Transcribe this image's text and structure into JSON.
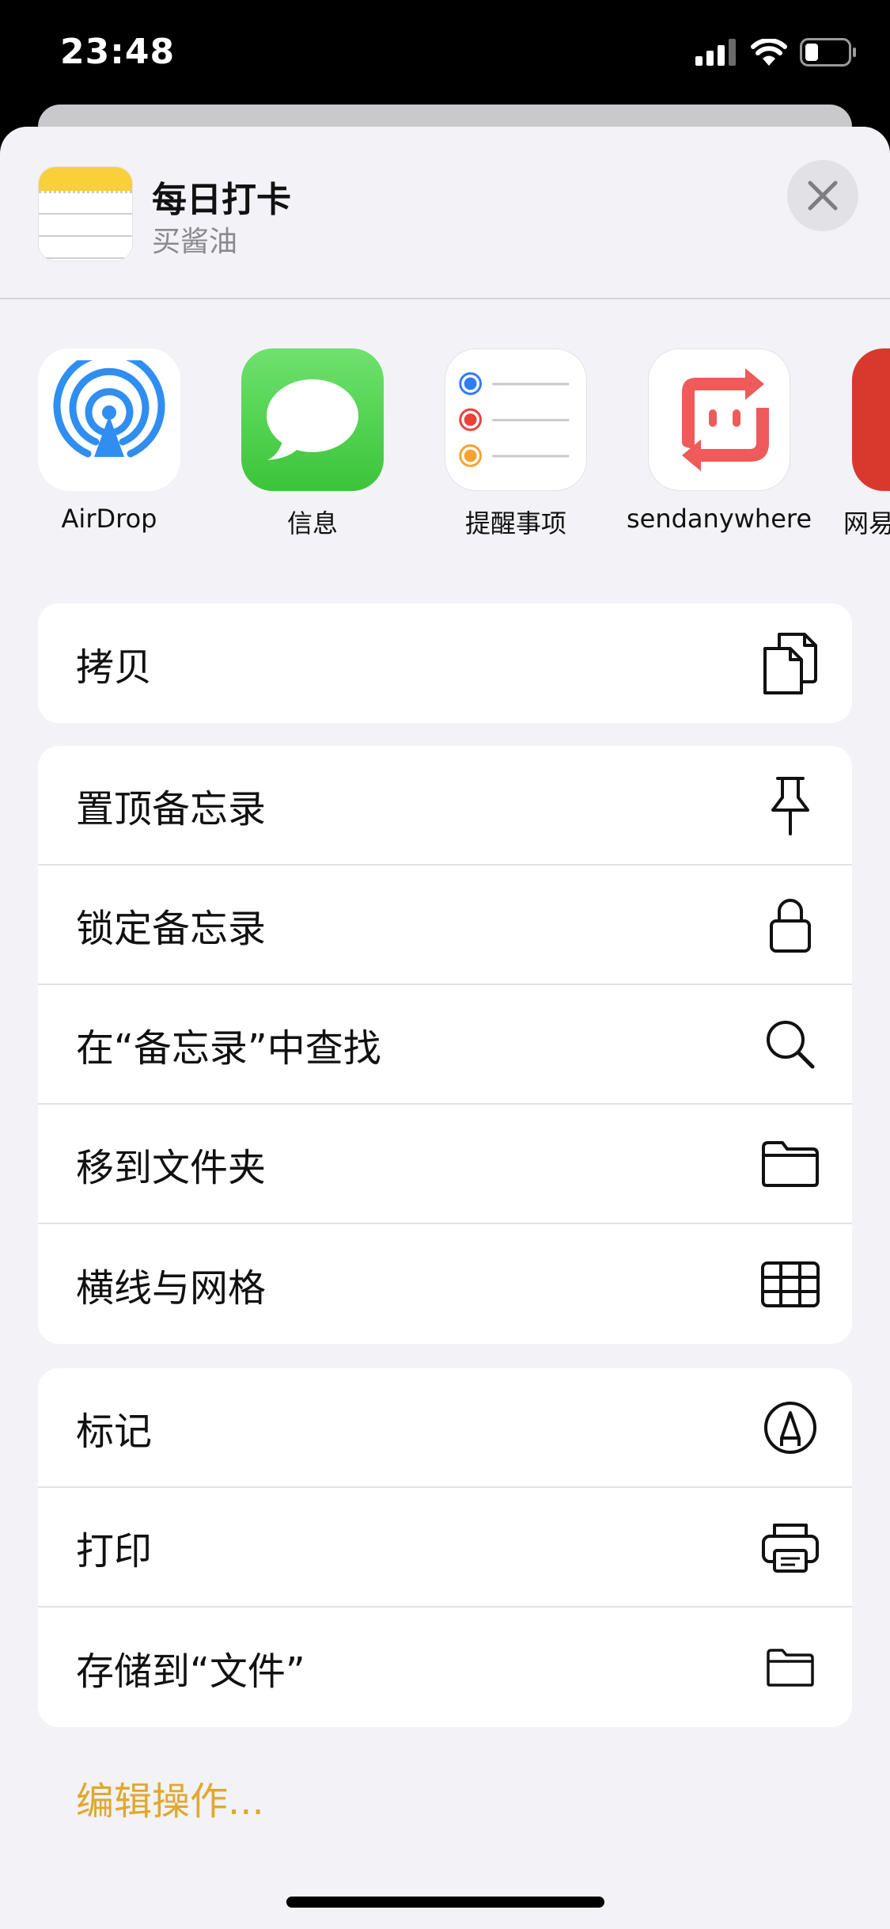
{
  "status_bar": {
    "time": "23:48",
    "icons": [
      "signal-icon",
      "wifi-icon",
      "battery-icon"
    ]
  },
  "header": {
    "title": "每日打卡",
    "subtitle": "买酱油",
    "icon": "notes-app-icon",
    "close_icon": "close-icon"
  },
  "apps": [
    {
      "label": "AirDrop",
      "icon": "airdrop-icon",
      "color": "#2f8ef0"
    },
    {
      "label": "信息",
      "icon": "messages-icon",
      "color": "#4cd964"
    },
    {
      "label": "提醒事项",
      "icon": "reminders-icon",
      "color": "#ffffff"
    },
    {
      "label": "sendanywhere",
      "icon": "sendanywhere-icon",
      "color": "#ef5a5a"
    },
    {
      "label": "网易",
      "icon": "netease-icon",
      "color": "#d8392c"
    }
  ],
  "groups": [
    {
      "items": [
        {
          "label": "拷贝",
          "icon": "copy-icon"
        }
      ]
    },
    {
      "items": [
        {
          "label": "置顶备忘录",
          "icon": "pin-icon"
        },
        {
          "label": "锁定备忘录",
          "icon": "lock-icon"
        },
        {
          "label": "在“备忘录”中查找",
          "icon": "search-icon"
        },
        {
          "label": "移到文件夹",
          "icon": "folder-icon"
        },
        {
          "label": "横线与网格",
          "icon": "grid-icon"
        }
      ]
    },
    {
      "items": [
        {
          "label": "标记",
          "icon": "markup-icon"
        },
        {
          "label": "打印",
          "icon": "print-icon"
        },
        {
          "label": "存储到“文件”",
          "icon": "save-to-files-icon"
        }
      ]
    }
  ],
  "edit_actions_label": "编辑操作...",
  "colors": {
    "accent": "#e0a82e",
    "sheet_bg": "#f2f2f7",
    "notes_yellow": "#f9cf3a"
  }
}
